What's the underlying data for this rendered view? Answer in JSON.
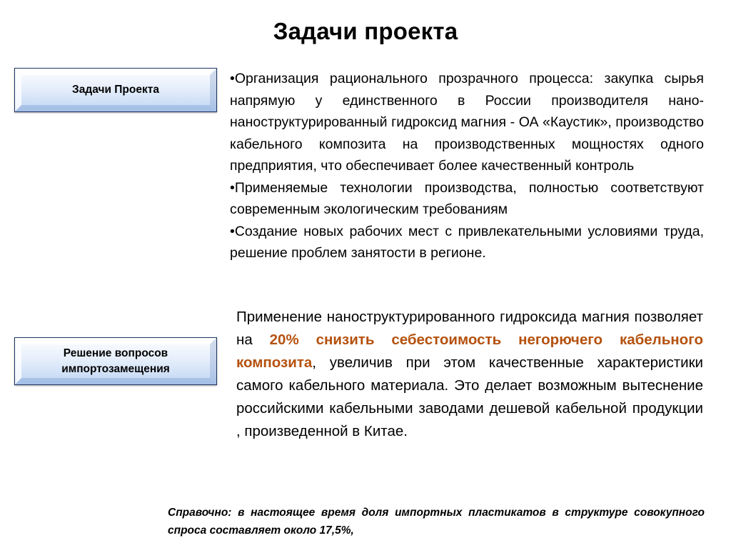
{
  "slide": {
    "title": "Задачи проекта",
    "background_color": "#ffffff",
    "accent_color": "#b5510e",
    "badge_border_color": "#1f3864"
  },
  "badges": [
    {
      "id": "tasks",
      "label": "Задачи Проекта"
    },
    {
      "id": "import_substitution",
      "label": "Решение вопросов\nимпортозамещения"
    }
  ],
  "bullets": {
    "marker": "•",
    "items": [
      "Организация рационального прозрачного процесса: закупка сырья напрямую у единственного в России производителя нано- наноструктурированный гидроксид магния - ОА «Каустик», производство кабельного композита на производственных мощностях одного предприятия, что обеспечивает более качественный контроль",
      "Применяемые технологии производства, полностью соответствуют современным экологическим требованиям",
      "Создание новых рабочих мест с привлекательными условиями труда, решение проблем занятости в регионе."
    ]
  },
  "import_paragraph": {
    "lead": "Применение наноструктурированного гидроксида магния позволяет на ",
    "highlight": "20% снизить себестоимость негорючего кабельного композита",
    "highlight_color": "#b5510e",
    "tail": ", увеличив при этом качественные характеристики самого кабельного материала.  Это делает возможным вытеснение российскими кабельными заводами дешевой кабельной продукции , произведенной в Китае."
  },
  "footnote": {
    "text": "Справочно: в настоящее время доля импортных пластикатов в структуре совокупного спроса составляет около 17,5%,"
  }
}
